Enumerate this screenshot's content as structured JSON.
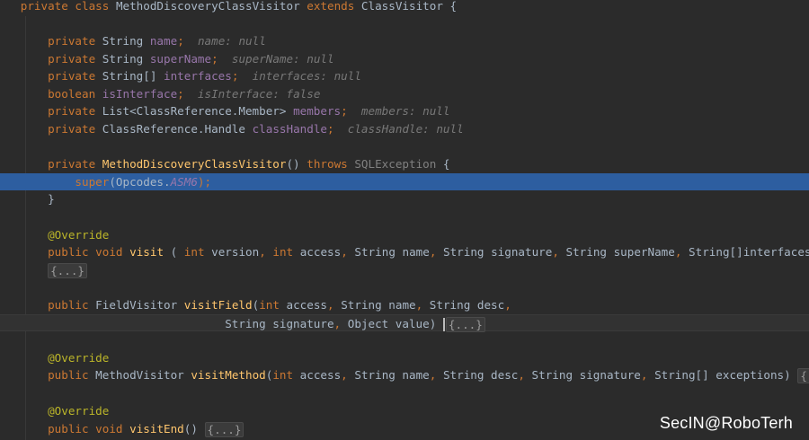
{
  "colors": {
    "background": "#2b2b2b",
    "keyword": "#cc7832",
    "field": "#9876aa",
    "method": "#ffc66d",
    "default_text": "#a9b7c6",
    "inlay_hint": "#787878",
    "annotation": "#bbb529",
    "selection": "#2d5ea0"
  },
  "code": {
    "class_decl": {
      "kw1": "private",
      "kw2": "class",
      "name": "MethodDiscoveryClassVisitor",
      "kw3": "extends",
      "parent": "ClassVisitor",
      "brace": " {"
    },
    "fields": [
      {
        "mod": "private",
        "type": "String",
        "name": "name",
        "hint": "name: null"
      },
      {
        "mod": "private",
        "type": "String",
        "name": "superName",
        "hint": "superName: null"
      },
      {
        "mod": "private",
        "type": "String[]",
        "name": "interfaces",
        "hint": "interfaces: null"
      },
      {
        "mod": "boolean",
        "type": "",
        "name": "isInterface",
        "hint": "isInterface: false"
      },
      {
        "mod": "private",
        "type": "List<ClassReference.Member>",
        "name": "members",
        "hint": "members: null"
      },
      {
        "mod": "private",
        "type": "ClassReference.Handle",
        "name": "classHandle",
        "hint": "classHandle: null"
      }
    ],
    "ctor": {
      "mod": "private",
      "name": "MethodDiscoveryClassVisitor",
      "parens": "()",
      "throws": "throws",
      "exc": "SQLException",
      "brace": " {"
    },
    "super_call": {
      "kw": "super",
      "open": "(Opcodes.",
      "const": "ASM6",
      "close": ");"
    },
    "close_brace": "}",
    "override": "@Override",
    "visit": {
      "kw1": "public",
      "kw2": "void",
      "name": "visit",
      "open": " ( ",
      "p1t": "int",
      "p1n": " version",
      "p2t": "int",
      "p2n": " access",
      "p3": "String name",
      "p4": "String signature",
      "p5": "String superName",
      "p6": "String[]interfaces)",
      "fold": "{...}"
    },
    "visitField": {
      "kw": "public",
      "type": "FieldVisitor",
      "name": "visitField",
      "open": "(",
      "p1t": "int",
      "p1n": " access",
      "p2": "String name",
      "p3": "String desc",
      "p4": "String signature",
      "p5": "Object value)",
      "fold": "{...}"
    },
    "visitMethod": {
      "kw": "public",
      "type": "MethodVisitor",
      "name": "visitMethod",
      "open": "(",
      "p1t": "int",
      "p1n": " access",
      "p2": "String name",
      "p3": "String desc",
      "p4": "String signature",
      "p5": "String[] exceptions)",
      "fold": "{...}"
    },
    "visitEnd": {
      "kw1": "public",
      "kw2": "void",
      "name": "visitEnd",
      "parens": "()",
      "fold": "{...}"
    }
  },
  "watermark": "SecIN@RoboTerh"
}
